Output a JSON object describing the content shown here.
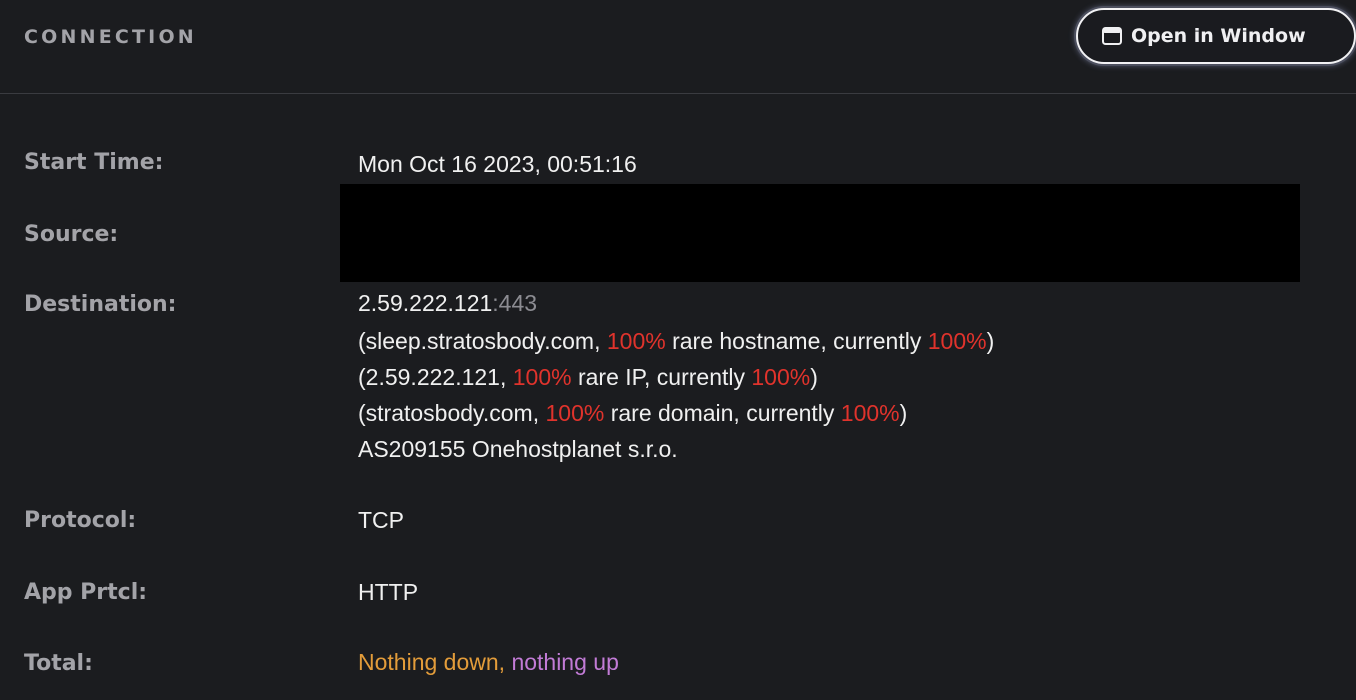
{
  "header": {
    "title": "CONNECTION",
    "open_button": {
      "label": "Open in Window",
      "icon": "window-icon"
    }
  },
  "fields": {
    "start_time": {
      "label": "Start Time:",
      "value": "Mon Oct 16 2023, 00:51:16"
    },
    "source": {
      "label": "Source:",
      "value_redacted": true
    },
    "destination": {
      "label": "Destination:",
      "ip": "2.59.222.121",
      "port": ":443",
      "hostname_line": {
        "open": "(sleep.stratosbody.com, ",
        "pct": "100%",
        "mid": " rare hostname, currently ",
        "pct2": "100%",
        "close": ")"
      },
      "ip_line": {
        "open": "(2.59.222.121, ",
        "pct": "100%",
        "mid": " rare IP, currently ",
        "pct2": "100%",
        "close": ")"
      },
      "domain_line": {
        "open": "(stratosbody.com, ",
        "pct": "100%",
        "mid": " rare domain, currently ",
        "pct2": "100%",
        "close": ")"
      },
      "asn": "AS209155 Onehostplanet s.r.o."
    },
    "protocol": {
      "label": "Protocol:",
      "value": "TCP"
    },
    "app_protocol": {
      "label": "App Prtcl:",
      "value": "HTTP"
    },
    "total": {
      "label": "Total:",
      "down": "Nothing down",
      "separator": ", ",
      "up": "nothing up"
    }
  },
  "colors": {
    "background": "#1b1c1f",
    "label": "#a3a3a8",
    "value": "#f0f0f0",
    "rare_highlight": "#e0332c",
    "port": "#8c8c92",
    "down": "#e39c3a",
    "up": "#c27bd6"
  }
}
